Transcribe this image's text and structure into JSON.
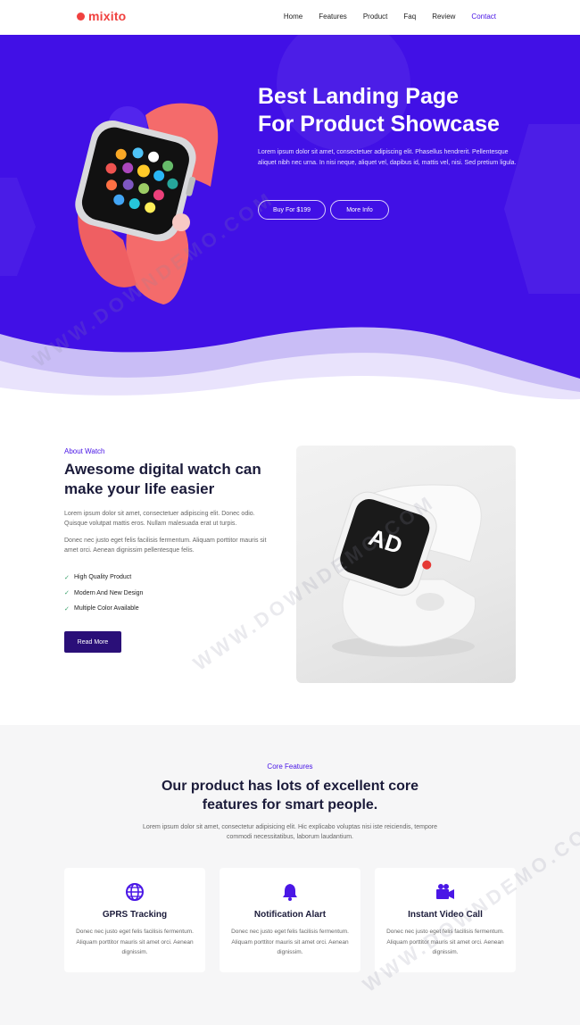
{
  "nav": {
    "logo": "mixito",
    "items": [
      {
        "label": "Home",
        "active": false
      },
      {
        "label": "Features",
        "active": false
      },
      {
        "label": "Product",
        "active": false
      },
      {
        "label": "Faq",
        "active": false
      },
      {
        "label": "Review",
        "active": false
      },
      {
        "label": "Contact",
        "active": true
      }
    ]
  },
  "hero": {
    "title_line1": "Best Landing Page",
    "title_line2": "For Product Showcase",
    "text": "Lorem ipsum dolor sit amet, consectetuer adipiscing elit. Phasellus hendrerit. Pellentesque aliquet nibh nec urna. In nisi neque, aliquet vel, dapibus id, mattis vel, nisi. Sed pretium ligula.",
    "buy_button": "Buy For $199",
    "more_button": "More Info"
  },
  "about": {
    "eyebrow": "About Watch",
    "title": "Awesome digital watch can make your life easier",
    "paragraph1": "Lorem ipsum dolor sit amet, consectetuer adipiscing elit. Donec odio. Quisque volutpat mattis eros. Nullam malesuada erat ut turpis.",
    "paragraph2": "Donec nec justo eget felis facilisis fermentum. Aliquam porttitor mauris sit amet orci. Aenean dignissim pellentesque felis.",
    "checklist": [
      "High Quality Product",
      "Modern And New Design",
      "Multiple Color Available"
    ],
    "button": "Read More"
  },
  "features": {
    "eyebrow": "Core Features",
    "title": "Our product has lots of excellent core features for smart people.",
    "text": "Lorem ipsum dolor sit amet, consectetur adipisicing elit. Hic explicabo voluptas nisi iste reiciendis, tempore commodi necessitatibus, laborum laudantium.",
    "cards": [
      {
        "icon": "globe-icon",
        "title": "GPRS Tracking",
        "text": "Donec nec justo eget felis facilisis fermentum. Aliquam porttitor mauris sit amet orci. Aenean dignissim."
      },
      {
        "icon": "bell-icon",
        "title": "Notification Alart",
        "text": "Donec nec justo eget felis facilisis fermentum. Aliquam porttitor mauris sit amet orci. Aenean dignissim."
      },
      {
        "icon": "video-camera-icon",
        "title": "Instant Video Call",
        "text": "Donec nec justo eget felis facilisis fermentum. Aliquam porttitor mauris sit amet orci. Aenean dignissim."
      }
    ]
  },
  "watermark": "WWW.DOWNDEMO.COM",
  "colors": {
    "brand": "#4110e6",
    "logo": "#f0413f",
    "button_dark": "#2a0f78",
    "check": "#3aa26b"
  }
}
